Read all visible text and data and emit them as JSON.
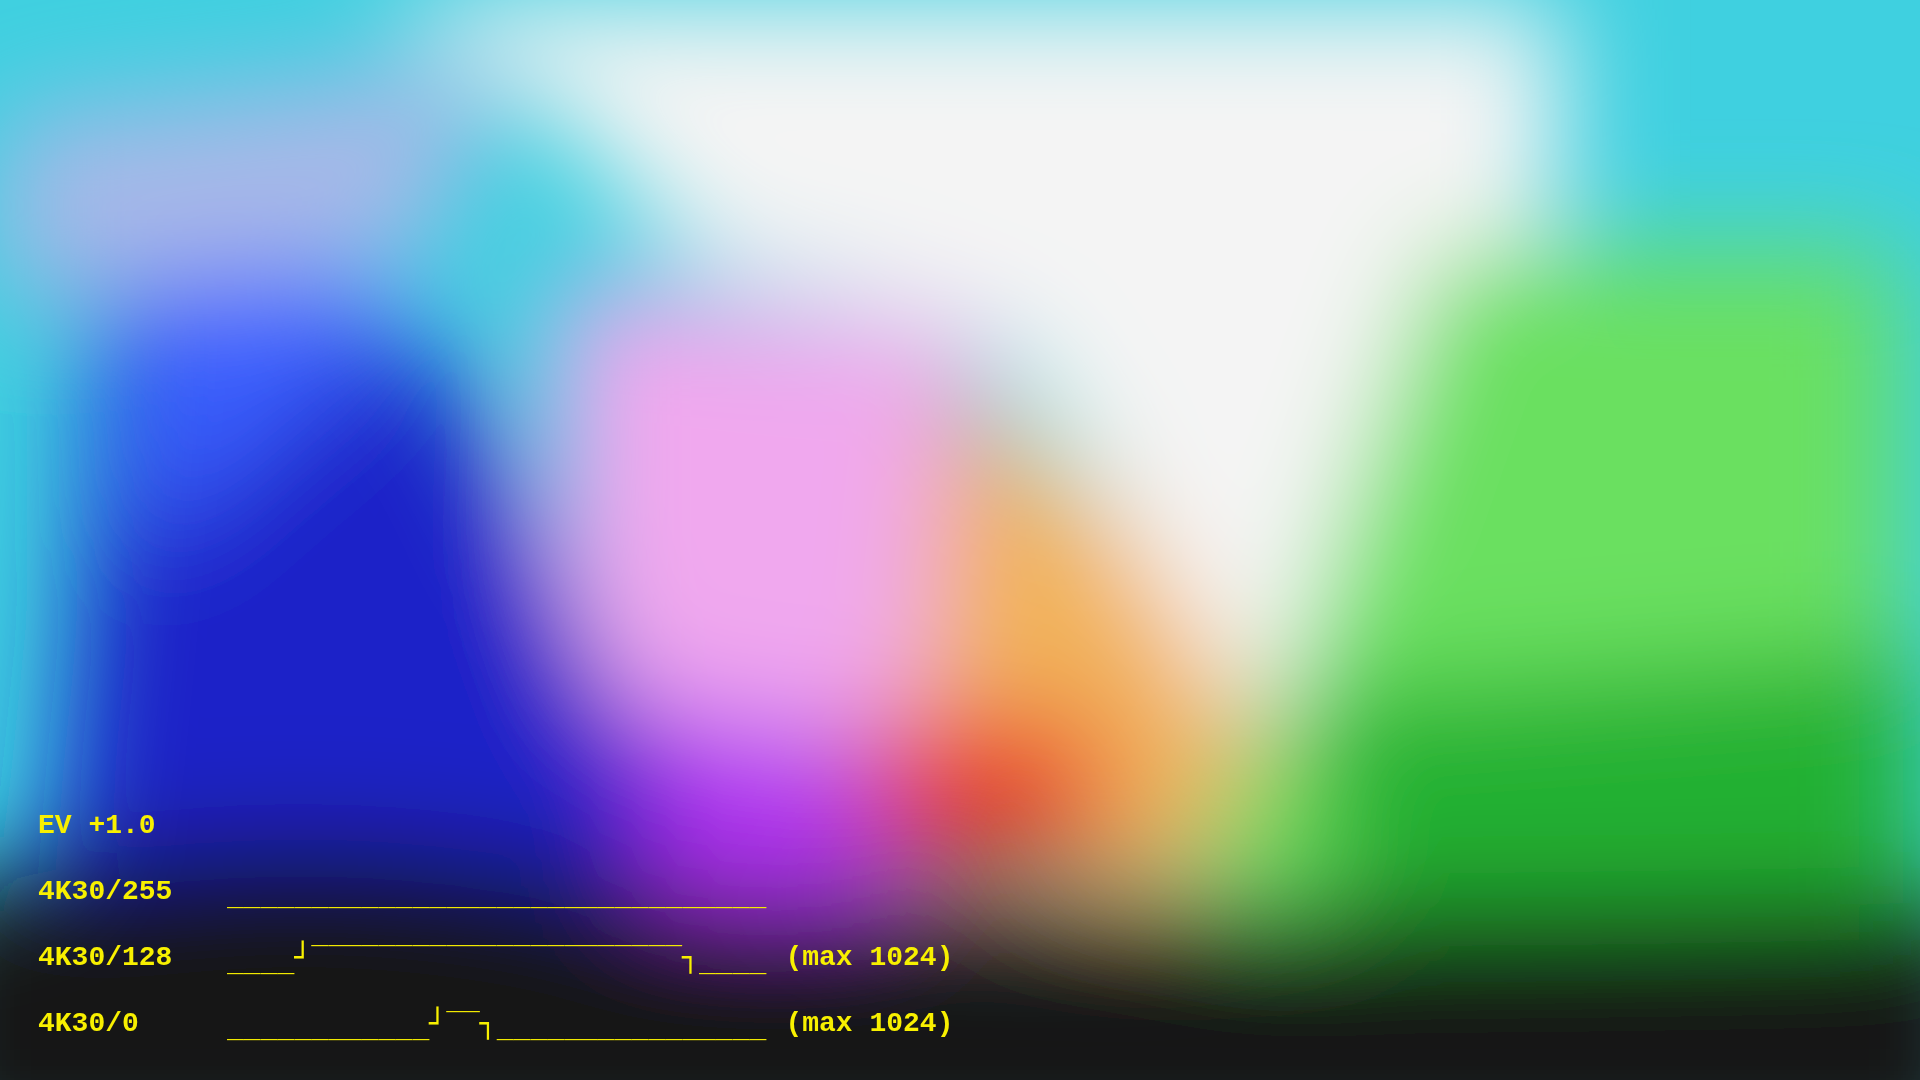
{
  "overlay": {
    "exposure": "EV +1.0",
    "rows": [
      {
        "label": "4K30/255",
        "trace": "________________________________"
      },
      {
        "label": "4K30/128",
        "trace": "____┘‾‾‾‾‾‾‾‾‾‾‾‾‾‾‾‾‾‾‾‾‾‾┐____",
        "note": "(max 1024)"
      },
      {
        "label": "4K30/0",
        "trace": "____________┘‾‾┐________________",
        "note": "(max 1024)"
      }
    ]
  }
}
